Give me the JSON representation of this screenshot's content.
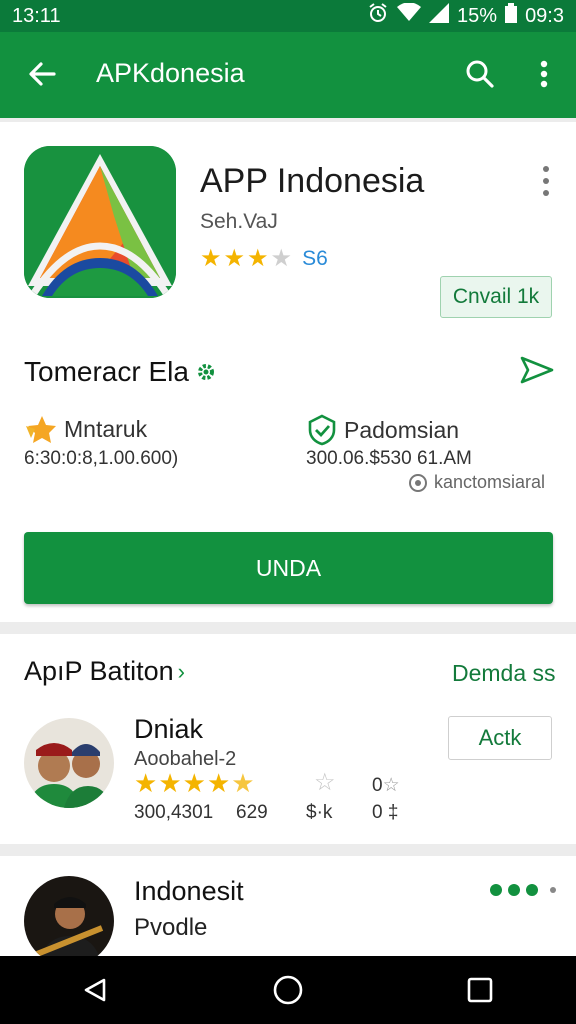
{
  "status_bar": {
    "time": "13:11",
    "battery": "15%",
    "clock": "09:3"
  },
  "app_bar": {
    "title": "APKdonesia"
  },
  "app": {
    "name": "APP Indonesia",
    "developer": "Seh.VaJ",
    "rating_stars": 3,
    "rating_count": "S6",
    "install_small_label": "Cnvail 1k"
  },
  "info": {
    "section_title": "Tomeracr Ela",
    "left_label": "Mntaruk",
    "left_value": "6:30:0:8,1.00.600)",
    "right_label": "Padomsian",
    "right_value": "300.06.$530 61.AM",
    "verified_text": "kanctomsiaral",
    "main_button_label": "UNDA"
  },
  "related": {
    "title": "ApıP Batiton",
    "link": "Demda ss",
    "item1": {
      "title": "Dniak",
      "subtitle": "Aoobahel-2",
      "stars": 4.5,
      "meta1": "300,4301",
      "meta2": "629",
      "meta3": "$·k",
      "meta4": "0 ‡",
      "side_value": "0",
      "install_label": "Actk"
    },
    "item2": {
      "title": "Indonesit",
      "subtitle": "Pvodle"
    }
  },
  "colors": {
    "primary": "#12913f",
    "status": "#0b7a3a",
    "star": "#f4b400"
  }
}
